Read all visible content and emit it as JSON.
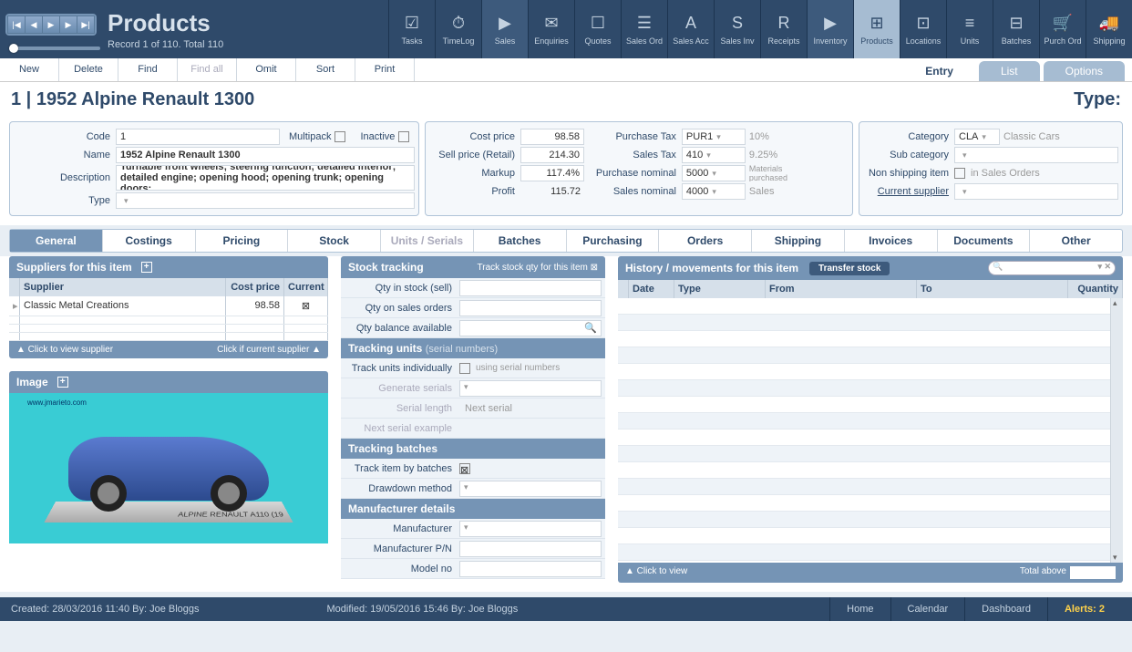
{
  "header": {
    "title": "Products",
    "record_status": "Record 1 of 110. Total 110"
  },
  "modules": [
    {
      "label": "Tasks",
      "icon": "☑"
    },
    {
      "label": "TimeLog",
      "icon": "⏱"
    },
    {
      "label": "Sales",
      "icon": "▶",
      "sub": true
    },
    {
      "label": "Enquiries",
      "icon": "✉"
    },
    {
      "label": "Quotes",
      "icon": "☐"
    },
    {
      "label": "Sales Ord",
      "icon": "☰"
    },
    {
      "label": "Sales Acc",
      "icon": "A"
    },
    {
      "label": "Sales Inv",
      "icon": "S"
    },
    {
      "label": "Receipts",
      "icon": "R"
    },
    {
      "label": "Inventory",
      "icon": "▶",
      "sub": true
    },
    {
      "label": "Products",
      "icon": "⊞",
      "active": true
    },
    {
      "label": "Locations",
      "icon": "⊡"
    },
    {
      "label": "Units",
      "icon": "≡"
    },
    {
      "label": "Batches",
      "icon": "⊟"
    },
    {
      "label": "Purch Ord",
      "icon": "🛒"
    },
    {
      "label": "Shipping",
      "icon": "🚚"
    }
  ],
  "actions": [
    {
      "label": "New"
    },
    {
      "label": "Delete"
    },
    {
      "label": "Find"
    },
    {
      "label": "Find all",
      "dim": true
    },
    {
      "label": "Omit"
    },
    {
      "label": "Sort"
    },
    {
      "label": "Print"
    }
  ],
  "right_tabs": {
    "entry": "Entry",
    "list": "List",
    "options": "Options"
  },
  "title_line": "1  |  1952 Alpine Renault 1300",
  "type_label": "Type:",
  "basic": {
    "code_lbl": "Code",
    "code": "1",
    "multipack": "Multipack",
    "inactive": "Inactive",
    "name_lbl": "Name",
    "name": "1952 Alpine Renault 1300",
    "desc_lbl": "Description",
    "desc": "Turnable front wheels; steering function; detailed interior; detailed engine; opening hood; opening trunk; opening doors;",
    "type_lbl": "Type"
  },
  "pricing": {
    "cost_lbl": "Cost price",
    "cost": "98.58",
    "sell_lbl": "Sell price (Retail)",
    "sell": "214.30",
    "markup_lbl": "Markup",
    "markup": "117.4%",
    "profit_lbl": "Profit",
    "profit": "115.72"
  },
  "tax": {
    "ptax_lbl": "Purchase Tax",
    "ptax": "PUR1",
    "ptax_rate": "10%",
    "stax_lbl": "Sales Tax",
    "stax": "410",
    "stax_rate": "9.25%",
    "pnom_lbl": "Purchase nominal",
    "pnom": "5000",
    "pnom_txt": "Materials purchased",
    "snom_lbl": "Sales nominal",
    "snom": "4000",
    "snom_txt": "Sales"
  },
  "category": {
    "cat_lbl": "Category",
    "cat": "CLA",
    "cat_txt": "Classic Cars",
    "sub_lbl": "Sub category",
    "ship_lbl": "Non shipping item",
    "ship_txt": "in Sales Orders",
    "supplier_lbl": "Current supplier"
  },
  "sub_tabs": [
    {
      "l": "General",
      "active": true
    },
    {
      "l": "Costings"
    },
    {
      "l": "Pricing"
    },
    {
      "l": "Stock"
    },
    {
      "l": "Units / Serials",
      "dim": true
    },
    {
      "l": "Batches"
    },
    {
      "l": "Purchasing"
    },
    {
      "l": "Orders"
    },
    {
      "l": "Shipping"
    },
    {
      "l": "Invoices"
    },
    {
      "l": "Documents"
    },
    {
      "l": "Other"
    }
  ],
  "suppliers": {
    "title": "Suppliers for this item",
    "cols": {
      "supplier": "Supplier",
      "cost": "Cost price",
      "current": "Current"
    },
    "rows": [
      {
        "name": "Classic Metal Creations",
        "cost": "98.58",
        "current": "⊠"
      }
    ],
    "foot_l": "▲  Click to view supplier",
    "foot_r": "Click if current supplier  ▲"
  },
  "image": {
    "title": "Image",
    "watermark": "www.jmarieto.com",
    "caption": "ALPINE RENAULT A110 (19"
  },
  "stock": {
    "title": "Stock tracking",
    "hint": "Track stock qty for this item ⊠",
    "qty_stock": "Qty in stock (sell)",
    "qty_orders": "Qty on sales orders",
    "qty_bal": "Qty balance available",
    "units_title": "Tracking units",
    "units_hint": "(serial numbers)",
    "track_ind": "Track units individually",
    "using_serial": "using serial numbers",
    "gen_serials": "Generate serials",
    "serial_len": "Serial length",
    "next_serial": "Next serial",
    "next_example": "Next serial example",
    "batches_title": "Tracking batches",
    "track_batch": "Track item by batches",
    "drawdown": "Drawdown method",
    "manuf_title": "Manufacturer details",
    "manuf": "Manufacturer",
    "manuf_pn": "Manufacturer P/N",
    "model": "Model no"
  },
  "history": {
    "title": "History / movements for this item",
    "transfer": "Transfer stock",
    "cols": {
      "date": "Date",
      "type": "Type",
      "from": "From",
      "to": "To",
      "qty": "Quantity"
    },
    "foot_l": "▲  Click to view",
    "foot_r": "Total above"
  },
  "footer": {
    "created": "Created:  28/03/2016  11:40    By:  Joe Bloggs",
    "modified": "Modified:  19/05/2016  15:46    By:  Joe Bloggs",
    "home": "Home",
    "calendar": "Calendar",
    "dashboard": "Dashboard",
    "alerts": "Alerts: 2"
  }
}
